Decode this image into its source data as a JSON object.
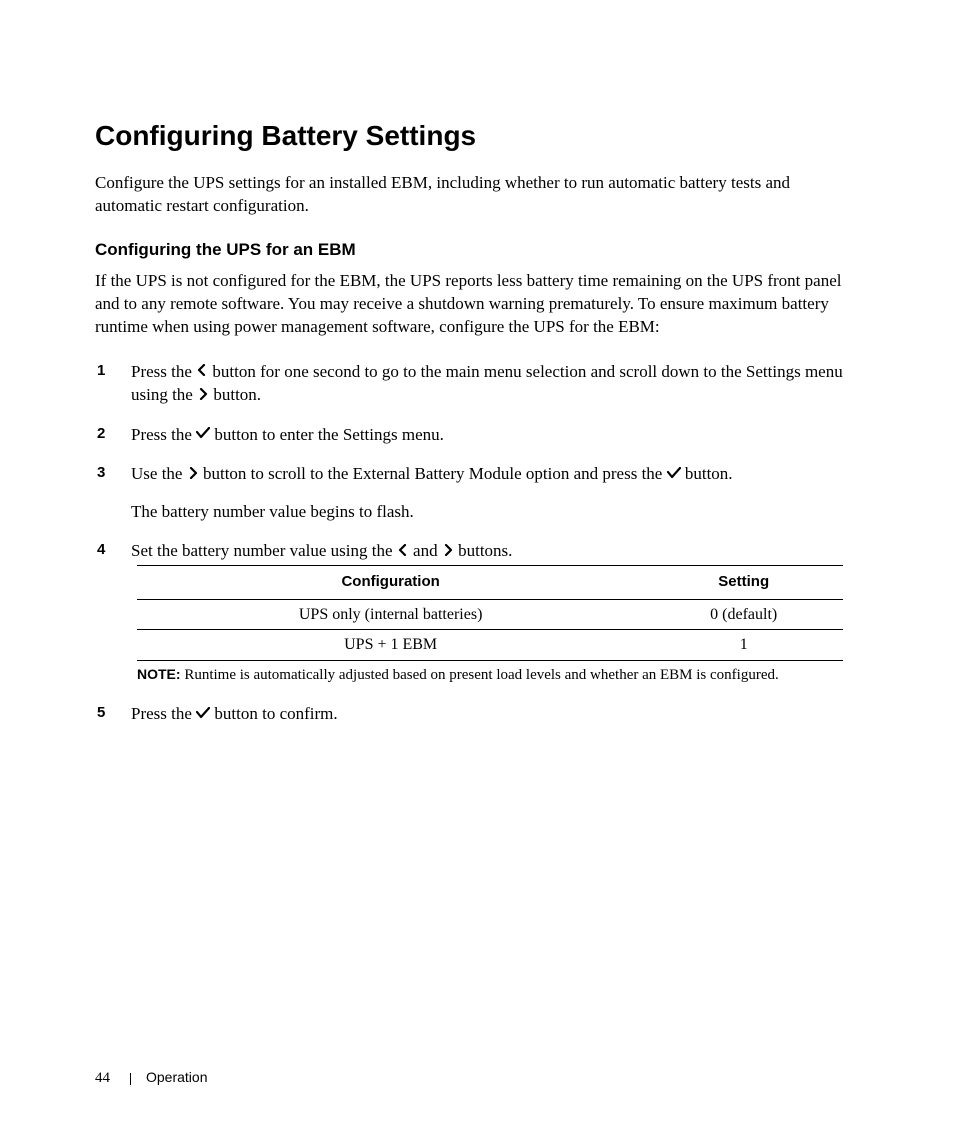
{
  "heading1": "Configuring Battery Settings",
  "intro": "Configure the UPS settings for an installed EBM, including whether to run automatic battery tests and automatic restart configuration.",
  "heading2": "Configuring the UPS for an EBM",
  "subintro": "If the UPS is not configured for the EBM, the UPS reports less battery time remaining on the UPS front panel and to any remote software. You may receive a shutdown warning prematurely. To ensure maximum battery runtime when using power management software, configure the UPS for the EBM:",
  "steps": {
    "s1a": "Press the ",
    "s1b": " button for one second to go to the main menu selection and scroll down to the Settings menu using the ",
    "s1c": " button.",
    "s2a": "Press the ",
    "s2b": " button to enter the Settings menu.",
    "s3a": "Use the ",
    "s3b": " button to scroll to the External Battery Module option and press the ",
    "s3c": " button.",
    "s3sub": "The battery number value begins to flash.",
    "s4a": "Set the battery number value using the ",
    "s4b": " and ",
    "s4c": " buttons.",
    "s5a": "Press the ",
    "s5b": " button to confirm."
  },
  "table": {
    "h1": "Configuration",
    "h2": "Setting",
    "r1c1": "UPS only (internal batteries)",
    "r1c2": "0 (default)",
    "r2c1": "UPS + 1 EBM",
    "r2c2": "1"
  },
  "note_label": "NOTE:",
  "note_text": " Runtime is automatically adjusted based on present load levels and whether an EBM is configured.",
  "footer": {
    "page": "44",
    "section": "Operation"
  }
}
